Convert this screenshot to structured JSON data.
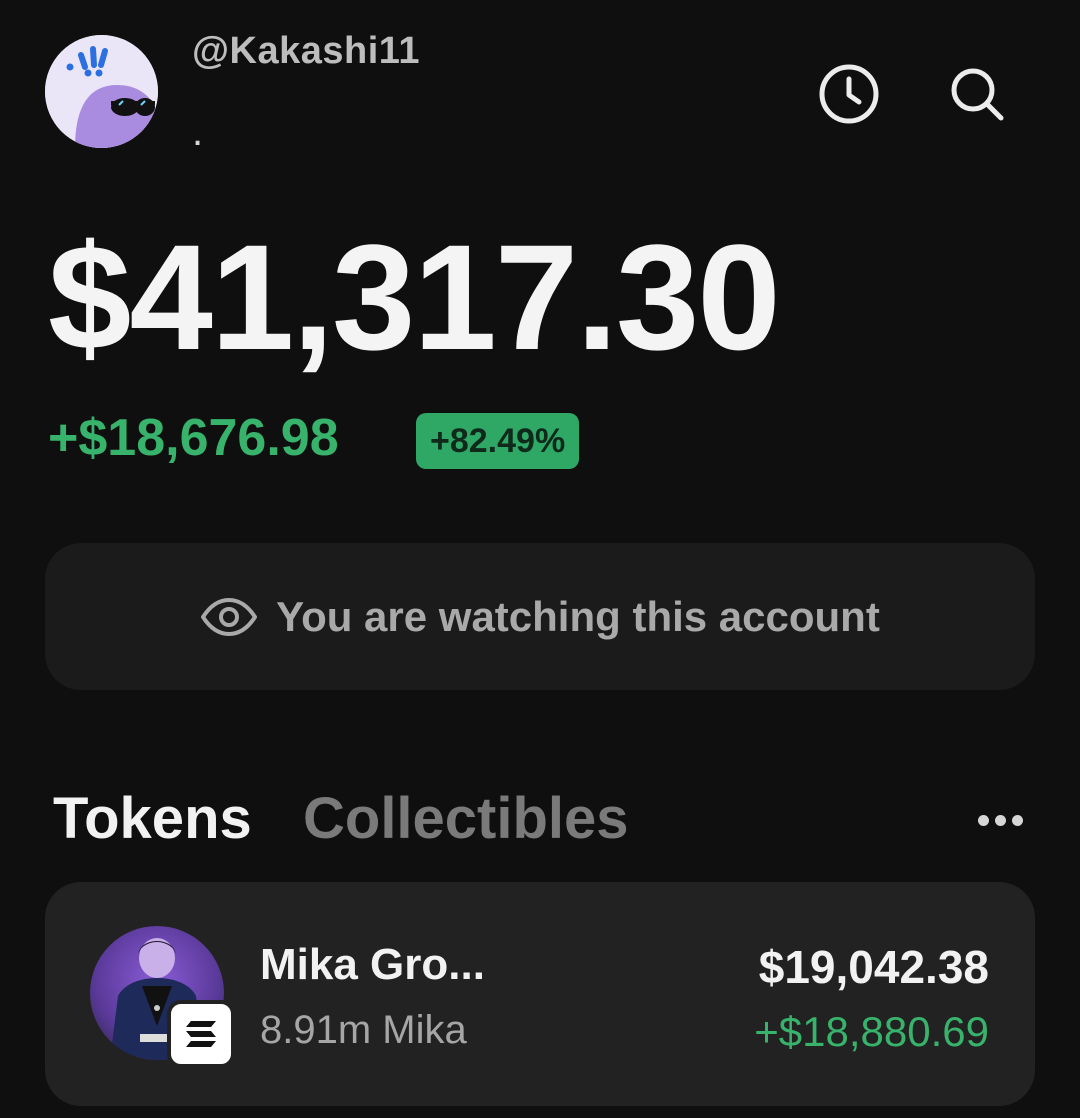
{
  "header": {
    "username": "@Kakashi11",
    "subline": ".",
    "history_icon": "clock-icon",
    "search_icon": "search-icon"
  },
  "portfolio": {
    "balance": "$41,317.30",
    "change_amount": "+$18,676.98",
    "change_percent": "+82.49%"
  },
  "watch_banner": {
    "icon": "eye-icon",
    "text": "You are watching this account"
  },
  "tabs": [
    {
      "label": "Tokens",
      "active": true
    },
    {
      "label": "Collectibles",
      "active": false
    }
  ],
  "more_icon": "ellipsis-icon",
  "tokens": [
    {
      "name": "Mika Gro...",
      "amount": "8.91m Mika",
      "value": "$19,042.38",
      "change": "+$18,880.69",
      "chain_icon": "solana-icon"
    }
  ],
  "colors": {
    "background": "#0f0f0f",
    "positive": "#37b36b",
    "badge": "#2fa866",
    "card": "#222222"
  }
}
